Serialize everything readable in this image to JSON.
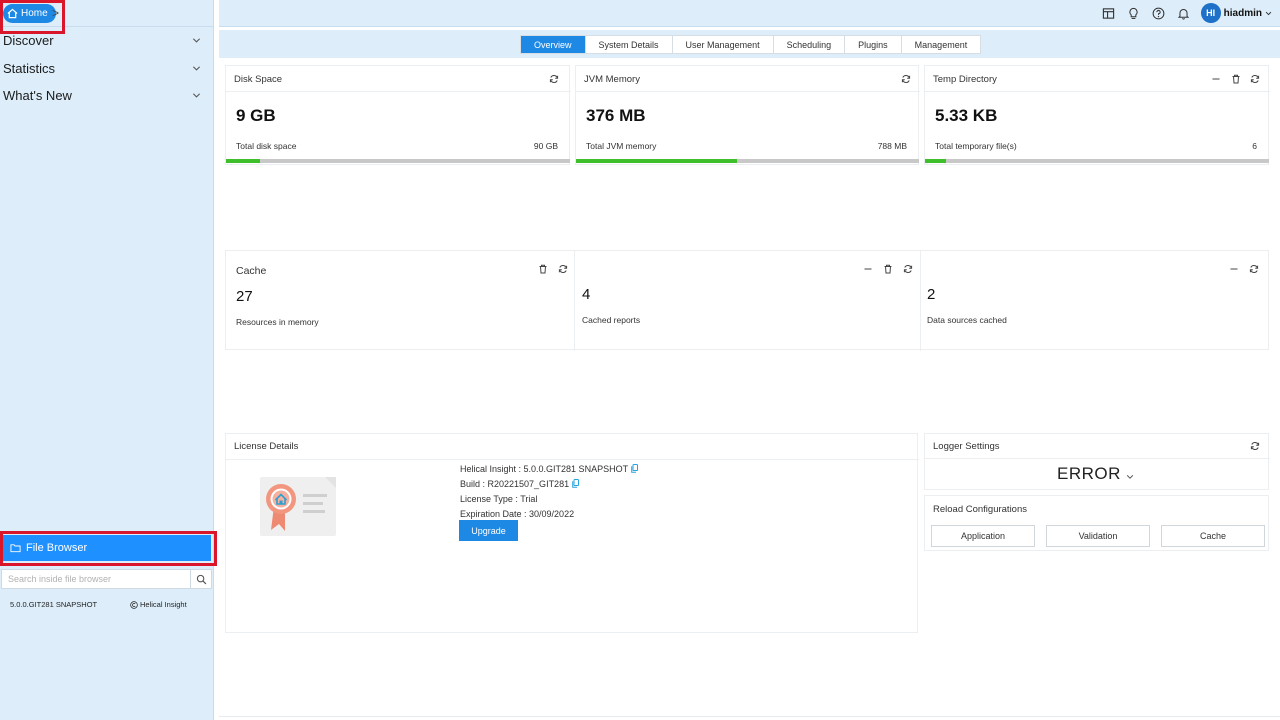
{
  "breadcrumb": {
    "home_label": "Home",
    "separator": ">"
  },
  "sidebar": {
    "items": [
      {
        "label": "Discover"
      },
      {
        "label": "Statistics"
      },
      {
        "label": "What's New"
      }
    ],
    "file_browser_label": "File Browser",
    "search_placeholder": "Search inside file browser",
    "version": "5.0.0.GIT281 SNAPSHOT",
    "brand": "Helical Insight"
  },
  "topbar": {
    "avatar_initials": "HI",
    "username": "hiadmin"
  },
  "tabs": [
    {
      "label": "Overview",
      "active": true
    },
    {
      "label": "System Details",
      "active": false
    },
    {
      "label": "User Management",
      "active": false
    },
    {
      "label": "Scheduling",
      "active": false
    },
    {
      "label": "Plugins",
      "active": false
    },
    {
      "label": "Management",
      "active": false
    }
  ],
  "disk": {
    "title": "Disk Space",
    "value": "9 GB",
    "label": "Total disk space",
    "total": "90 GB",
    "fill_fraction": 0.1
  },
  "jvm": {
    "title": "JVM Memory",
    "value": "376 MB",
    "label": "Total JVM memory",
    "total": "788 MB",
    "fill_fraction": 0.47
  },
  "temp": {
    "title": "Temp Directory",
    "value": "5.33 KB",
    "label": "Total temporary file(s)",
    "total": "6",
    "fill_fraction": 0.06
  },
  "cache": {
    "title": "Cache",
    "resources_value": "27",
    "resources_label": "Resources in memory",
    "reports_value": "4",
    "reports_label": "Cached reports",
    "datasources_value": "2",
    "datasources_label": "Data sources cached"
  },
  "license": {
    "title": "License Details",
    "version_line": "Helical Insight : 5.0.0.GIT281 SNAPSHOT",
    "build_line": "Build : R20221507_GIT281",
    "type_line": "License Type : Trial",
    "expiry_line": "Expiration Date : 30/09/2022",
    "upgrade_label": "Upgrade"
  },
  "logger": {
    "title": "Logger Settings",
    "level": "ERROR"
  },
  "reload": {
    "title": "Reload Configurations",
    "buttons": [
      "Application",
      "Validation",
      "Cache"
    ]
  },
  "colors": {
    "accent": "#1e88e5",
    "progress": "#3fbf2c",
    "sidebar_bg": "#ddeefa",
    "highlight_box": "#d9162a"
  }
}
